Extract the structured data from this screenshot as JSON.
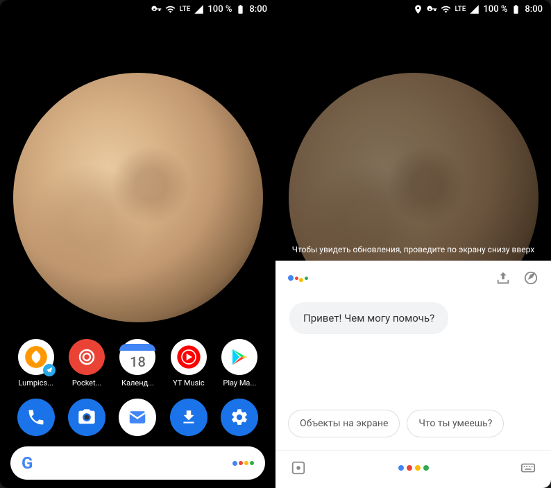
{
  "status": {
    "battery": "100 %",
    "time": "8:00",
    "network": "LTE"
  },
  "apps": [
    {
      "label": "Lumpics..."
    },
    {
      "label": "Pocket..."
    },
    {
      "label": "Календ...",
      "day": "18"
    },
    {
      "label": "YT Music"
    },
    {
      "label": "Play Ма..."
    }
  ],
  "assistant": {
    "hint": "Чтобы увидеть обновления, проведите по экрану снизу вверх",
    "greeting": "Привет! Чем могу помочь?",
    "suggestions": [
      "Объекты на экране",
      "Что ты умеешь?"
    ]
  }
}
